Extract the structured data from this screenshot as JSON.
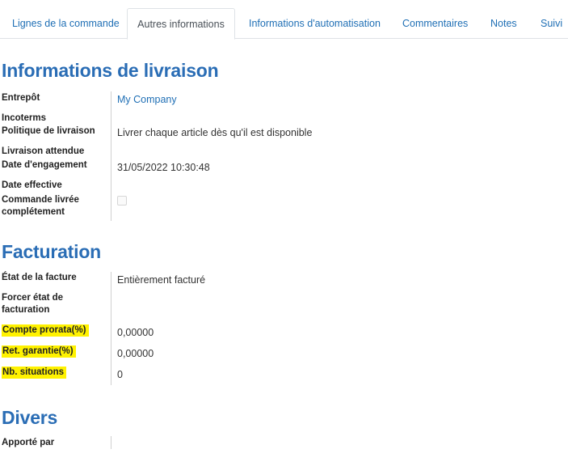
{
  "tabs": [
    {
      "label": "Lignes de la commande",
      "active": false
    },
    {
      "label": "Autres informations",
      "active": true
    },
    {
      "label": "Informations d'automatisation",
      "active": false
    },
    {
      "label": "Commentaires",
      "active": false
    },
    {
      "label": "Notes",
      "active": false
    },
    {
      "label": "Suivi",
      "active": false
    }
  ],
  "delivery": {
    "title": "Informations de livraison",
    "warehouse_label": "Entrepôt",
    "warehouse_value": "My Company",
    "incoterms_label": "Incoterms",
    "policy_label": "Politique de livraison",
    "policy_value": "Livrer chaque article dès qu'il est disponible",
    "expected_label": "Livraison attendue",
    "commitment_label": "Date d'engagement",
    "commitment_value": "31/05/2022 10:30:48",
    "effective_label": "Date effective",
    "fully_delivered_label": "Commande livrée complétement",
    "fully_delivered_checked": false
  },
  "billing": {
    "title": "Facturation",
    "invoice_status_label": "État de la facture",
    "invoice_status_value": "Entièrement facturé",
    "force_status_label": "Forcer état de facturation",
    "prorata_label": "Compte prorata(%)",
    "prorata_value": "0,00000",
    "retention_label": "Ret. garantie(%)",
    "retention_value": "0,00000",
    "situations_label": "Nb. situations",
    "situations_value": "0",
    "highlight_color": "#fff200"
  },
  "misc": {
    "title": "Divers",
    "source_label": "Apporté par"
  },
  "colors": {
    "accent": "#2a6db5",
    "link": "#1f6fb5"
  }
}
